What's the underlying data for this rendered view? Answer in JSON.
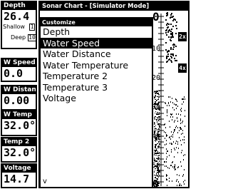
{
  "digital_data": {
    "depth": {
      "header": "Depth",
      "value": "26.4",
      "shallow_label": "Shallow",
      "shallow_value": "1",
      "deep_label": "Deep",
      "deep_value": "10"
    },
    "water_speed": {
      "header": "W Speed",
      "value": "0.0"
    },
    "water_distance": {
      "header": "W Distanc",
      "value": "0.00"
    },
    "water_temp": {
      "header": "W Temp",
      "value": "32.0°"
    },
    "temp2": {
      "header": "Temp 2",
      "value": "32.0°"
    },
    "voltage": {
      "header": "Voltage",
      "value": "14.7"
    }
  },
  "chart": {
    "title": "Sonar Chart - [Simulator Mode]",
    "depth_top": "0",
    "depth_bottom": "60",
    "scale_labels": [
      "10",
      "20",
      "30",
      "40",
      "50"
    ],
    "zoom_badges": [
      "2x",
      "4x"
    ]
  },
  "customize_menu": {
    "title": "Customize",
    "items": [
      "Depth",
      "Water Speed",
      "Water Distance",
      "Water Temperature",
      "Temperature 2",
      "Temperature 3",
      "Voltage"
    ],
    "selected_index": 1,
    "more_indicator": "v"
  }
}
